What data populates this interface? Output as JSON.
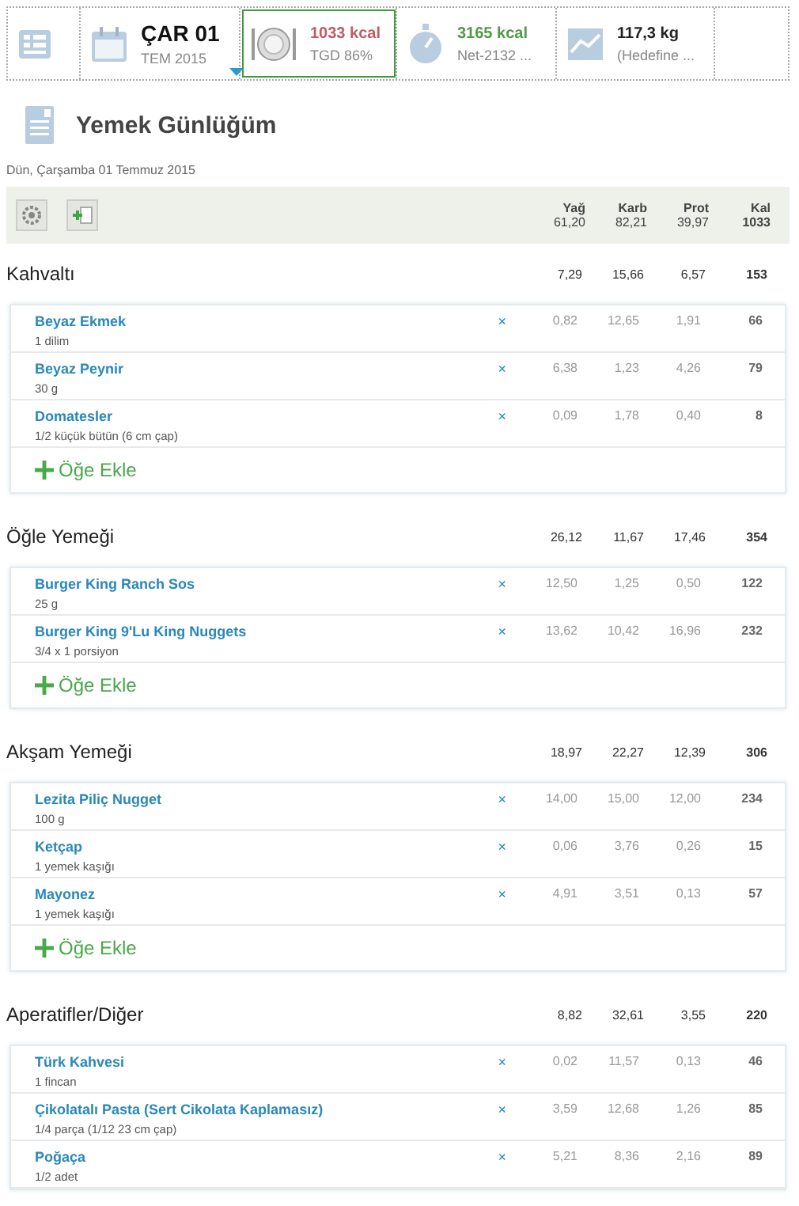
{
  "tiles": [
    {
      "kind": "menu",
      "selected": false
    },
    {
      "kind": "date",
      "title": "ÇAR 01",
      "subtitle": "TEM 2015",
      "selected": false
    },
    {
      "kind": "food",
      "title": "1033 kcal",
      "subtitle": "TGD 86%",
      "color": "#c25b63",
      "selected": true
    },
    {
      "kind": "exercise",
      "title": "3165 kcal",
      "subtitle": "Net-2132 ...",
      "color": "#4f9a46",
      "selected": false
    },
    {
      "kind": "weight",
      "title": "117,3 kg",
      "subtitle": "(Hedefine ...",
      "color": "#222222",
      "selected": false
    },
    {
      "kind": "empty"
    }
  ],
  "page_title": "Yemek Günlüğüm",
  "date_line": "Dün, Çarşamba 01 Temmuz 2015",
  "summary": {
    "columns": [
      "Yağ",
      "Karb",
      "Prot",
      "Kal"
    ],
    "totals": [
      "61,20",
      "82,21",
      "39,97",
      "1033"
    ]
  },
  "meals": [
    {
      "name": "Kahvaltı",
      "totals": [
        "7,29",
        "15,66",
        "6,57",
        "153"
      ],
      "add_label": "Öğe Ekle",
      "items": [
        {
          "name": "Beyaz Ekmek",
          "portion": "1 dilim",
          "remove": "×",
          "values": [
            "0,82",
            "12,65",
            "1,91",
            "66"
          ]
        },
        {
          "name": "Beyaz Peynir",
          "portion": "30 g",
          "remove": "×",
          "values": [
            "6,38",
            "1,23",
            "4,26",
            "79"
          ]
        },
        {
          "name": "Domatesler",
          "portion": "1/2 küçük bütün (6 cm çap)",
          "remove": "×",
          "values": [
            "0,09",
            "1,78",
            "0,40",
            "8"
          ]
        }
      ]
    },
    {
      "name": "Öğle Yemeği",
      "totals": [
        "26,12",
        "11,67",
        "17,46",
        "354"
      ],
      "add_label": "Öğe Ekle",
      "items": [
        {
          "name": "Burger King Ranch Sos",
          "portion": "25 g",
          "remove": "×",
          "values": [
            "12,50",
            "1,25",
            "0,50",
            "122"
          ]
        },
        {
          "name": "Burger King 9'Lu King Nuggets",
          "portion": "3/4 x 1 porsiyon",
          "remove": "×",
          "values": [
            "13,62",
            "10,42",
            "16,96",
            "232"
          ]
        }
      ]
    },
    {
      "name": "Akşam Yemeği",
      "totals": [
        "18,97",
        "22,27",
        "12,39",
        "306"
      ],
      "add_label": "Öğe Ekle",
      "items": [
        {
          "name": "Lezita Piliç Nugget",
          "portion": "100 g",
          "remove": "×",
          "values": [
            "14,00",
            "15,00",
            "12,00",
            "234"
          ]
        },
        {
          "name": "Ketçap",
          "portion": "1 yemek kaşığı",
          "remove": "×",
          "values": [
            "0,06",
            "3,76",
            "0,26",
            "15"
          ]
        },
        {
          "name": "Mayonez",
          "portion": "1 yemek kaşığı",
          "remove": "×",
          "values": [
            "4,91",
            "3,51",
            "0,13",
            "57"
          ]
        }
      ]
    },
    {
      "name": "Aperatifler/Diğer",
      "totals": [
        "8,82",
        "32,61",
        "3,55",
        "220"
      ],
      "items": [
        {
          "name": "Türk Kahvesi",
          "portion": "1 fincan",
          "remove": "×",
          "values": [
            "0,02",
            "11,57",
            "0,13",
            "46"
          ]
        },
        {
          "name": "Çikolatalı Pasta (Sert Cikolata Kaplamasız)",
          "portion": "1/4 parça (1/12 23 cm çap)",
          "remove": "×",
          "values": [
            "3,59",
            "12,68",
            "1,26",
            "85"
          ]
        },
        {
          "name": "Poğaça",
          "portion": "1/2 adet",
          "remove": "×",
          "values": [
            "5,21",
            "8,36",
            "2,16",
            "89"
          ]
        }
      ]
    }
  ]
}
